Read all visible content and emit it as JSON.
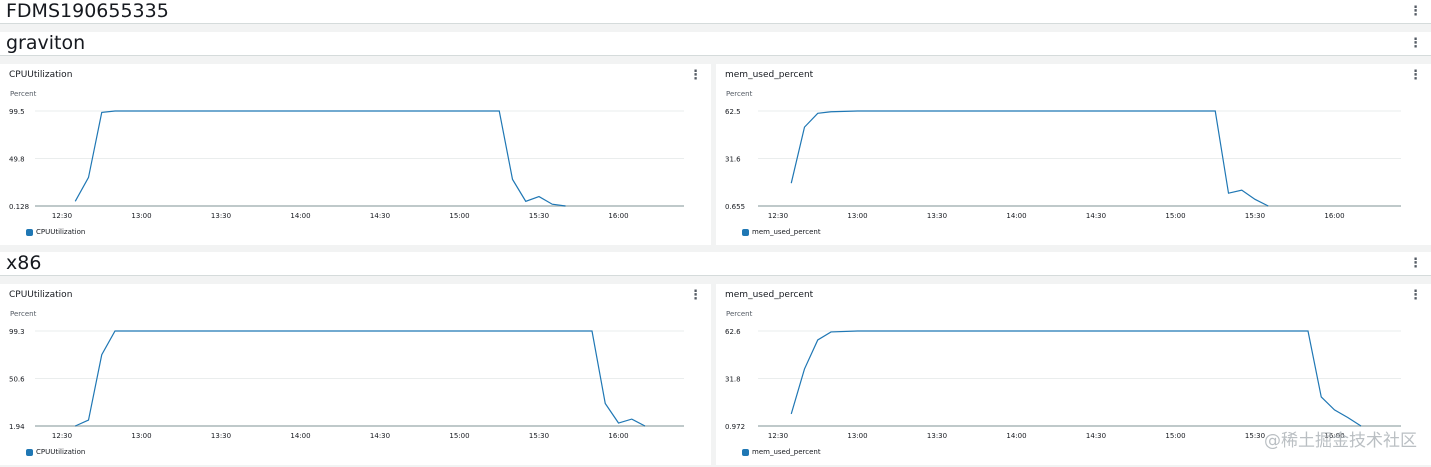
{
  "dashboard": {
    "title": "FDMS190655335"
  },
  "sections": [
    {
      "title": "graviton",
      "widgets": [
        {
          "title": "CPUUtilization",
          "y_label": "Percent",
          "legend": "CPUUtilization",
          "color": "#1f77b4"
        },
        {
          "title": "mem_used_percent",
          "y_label": "Percent",
          "legend": "mem_used_percent",
          "color": "#1f77b4"
        }
      ]
    },
    {
      "title": "x86",
      "widgets": [
        {
          "title": "CPUUtilization",
          "y_label": "Percent",
          "legend": "CPUUtilization",
          "color": "#1f77b4"
        },
        {
          "title": "mem_used_percent",
          "y_label": "Percent",
          "legend": "mem_used_percent",
          "color": "#1f77b4"
        }
      ]
    }
  ],
  "watermark": "@稀土掘金技术社区",
  "chart_data": [
    {
      "type": "line",
      "title": "CPUUtilization",
      "ylabel": "Percent",
      "yticks": [
        "0.128",
        "49.8",
        "99.5"
      ],
      "ylim": [
        0.128,
        99.5
      ],
      "xticks": [
        "12:30",
        "13:00",
        "13:30",
        "14:00",
        "14:30",
        "15:00",
        "15:30",
        "16:00"
      ],
      "grid": true,
      "legend": "bottom-left",
      "series": [
        {
          "name": "CPUUtilization",
          "x": [
            "12:35",
            "12:40",
            "12:45",
            "12:50",
            "15:15",
            "15:20",
            "15:25",
            "15:30",
            "15:35",
            "15:40"
          ],
          "y": [
            5,
            30,
            98,
            99.5,
            99.5,
            28,
            5,
            10,
            2,
            0.128
          ]
        }
      ]
    },
    {
      "type": "line",
      "title": "mem_used_percent",
      "ylabel": "Percent",
      "yticks": [
        "0.655",
        "31.6",
        "62.5"
      ],
      "ylim": [
        0.655,
        62.5
      ],
      "xticks": [
        "12:30",
        "13:00",
        "13:30",
        "14:00",
        "14:30",
        "15:00",
        "15:30",
        "16:00"
      ],
      "grid": true,
      "legend": "bottom-left",
      "series": [
        {
          "name": "mem_used_percent",
          "x": [
            "12:35",
            "12:40",
            "12:45",
            "12:50",
            "13:00",
            "15:15",
            "15:20",
            "15:25",
            "15:30",
            "15:35"
          ],
          "y": [
            15.5,
            52,
            61,
            62,
            62.5,
            62.5,
            9,
            11,
            5,
            0.655
          ]
        }
      ]
    },
    {
      "type": "line",
      "title": "CPUUtilization",
      "ylabel": "Percent",
      "yticks": [
        "1.94",
        "50.6",
        "99.3"
      ],
      "ylim": [
        1.94,
        99.3
      ],
      "xticks": [
        "12:30",
        "13:00",
        "13:30",
        "14:00",
        "14:30",
        "15:00",
        "15:30",
        "16:00"
      ],
      "grid": true,
      "legend": "bottom-left",
      "series": [
        {
          "name": "CPUUtilization",
          "x": [
            "12:35",
            "12:40",
            "12:45",
            "12:50",
            "15:50",
            "15:55",
            "16:00",
            "16:05",
            "16:10"
          ],
          "y": [
            1.94,
            8,
            75,
            99.3,
            99.3,
            25,
            5,
            9,
            1.94
          ]
        }
      ]
    },
    {
      "type": "line",
      "title": "mem_used_percent",
      "ylabel": "Percent",
      "yticks": [
        "0.972",
        "31.8",
        "62.6"
      ],
      "ylim": [
        0.972,
        62.6
      ],
      "xticks": [
        "12:30",
        "13:00",
        "13:30",
        "14:00",
        "14:30",
        "15:00",
        "15:30",
        "16:00"
      ],
      "grid": true,
      "legend": "bottom-left",
      "series": [
        {
          "name": "mem_used_percent",
          "x": [
            "12:35",
            "12:40",
            "12:45",
            "12:50",
            "13:00",
            "15:50",
            "15:55",
            "16:00",
            "16:05",
            "16:10"
          ],
          "y": [
            8.8,
            38,
            56.8,
            62,
            62.6,
            62.6,
            19.8,
            11.4,
            6.5,
            0.972
          ]
        }
      ]
    }
  ]
}
